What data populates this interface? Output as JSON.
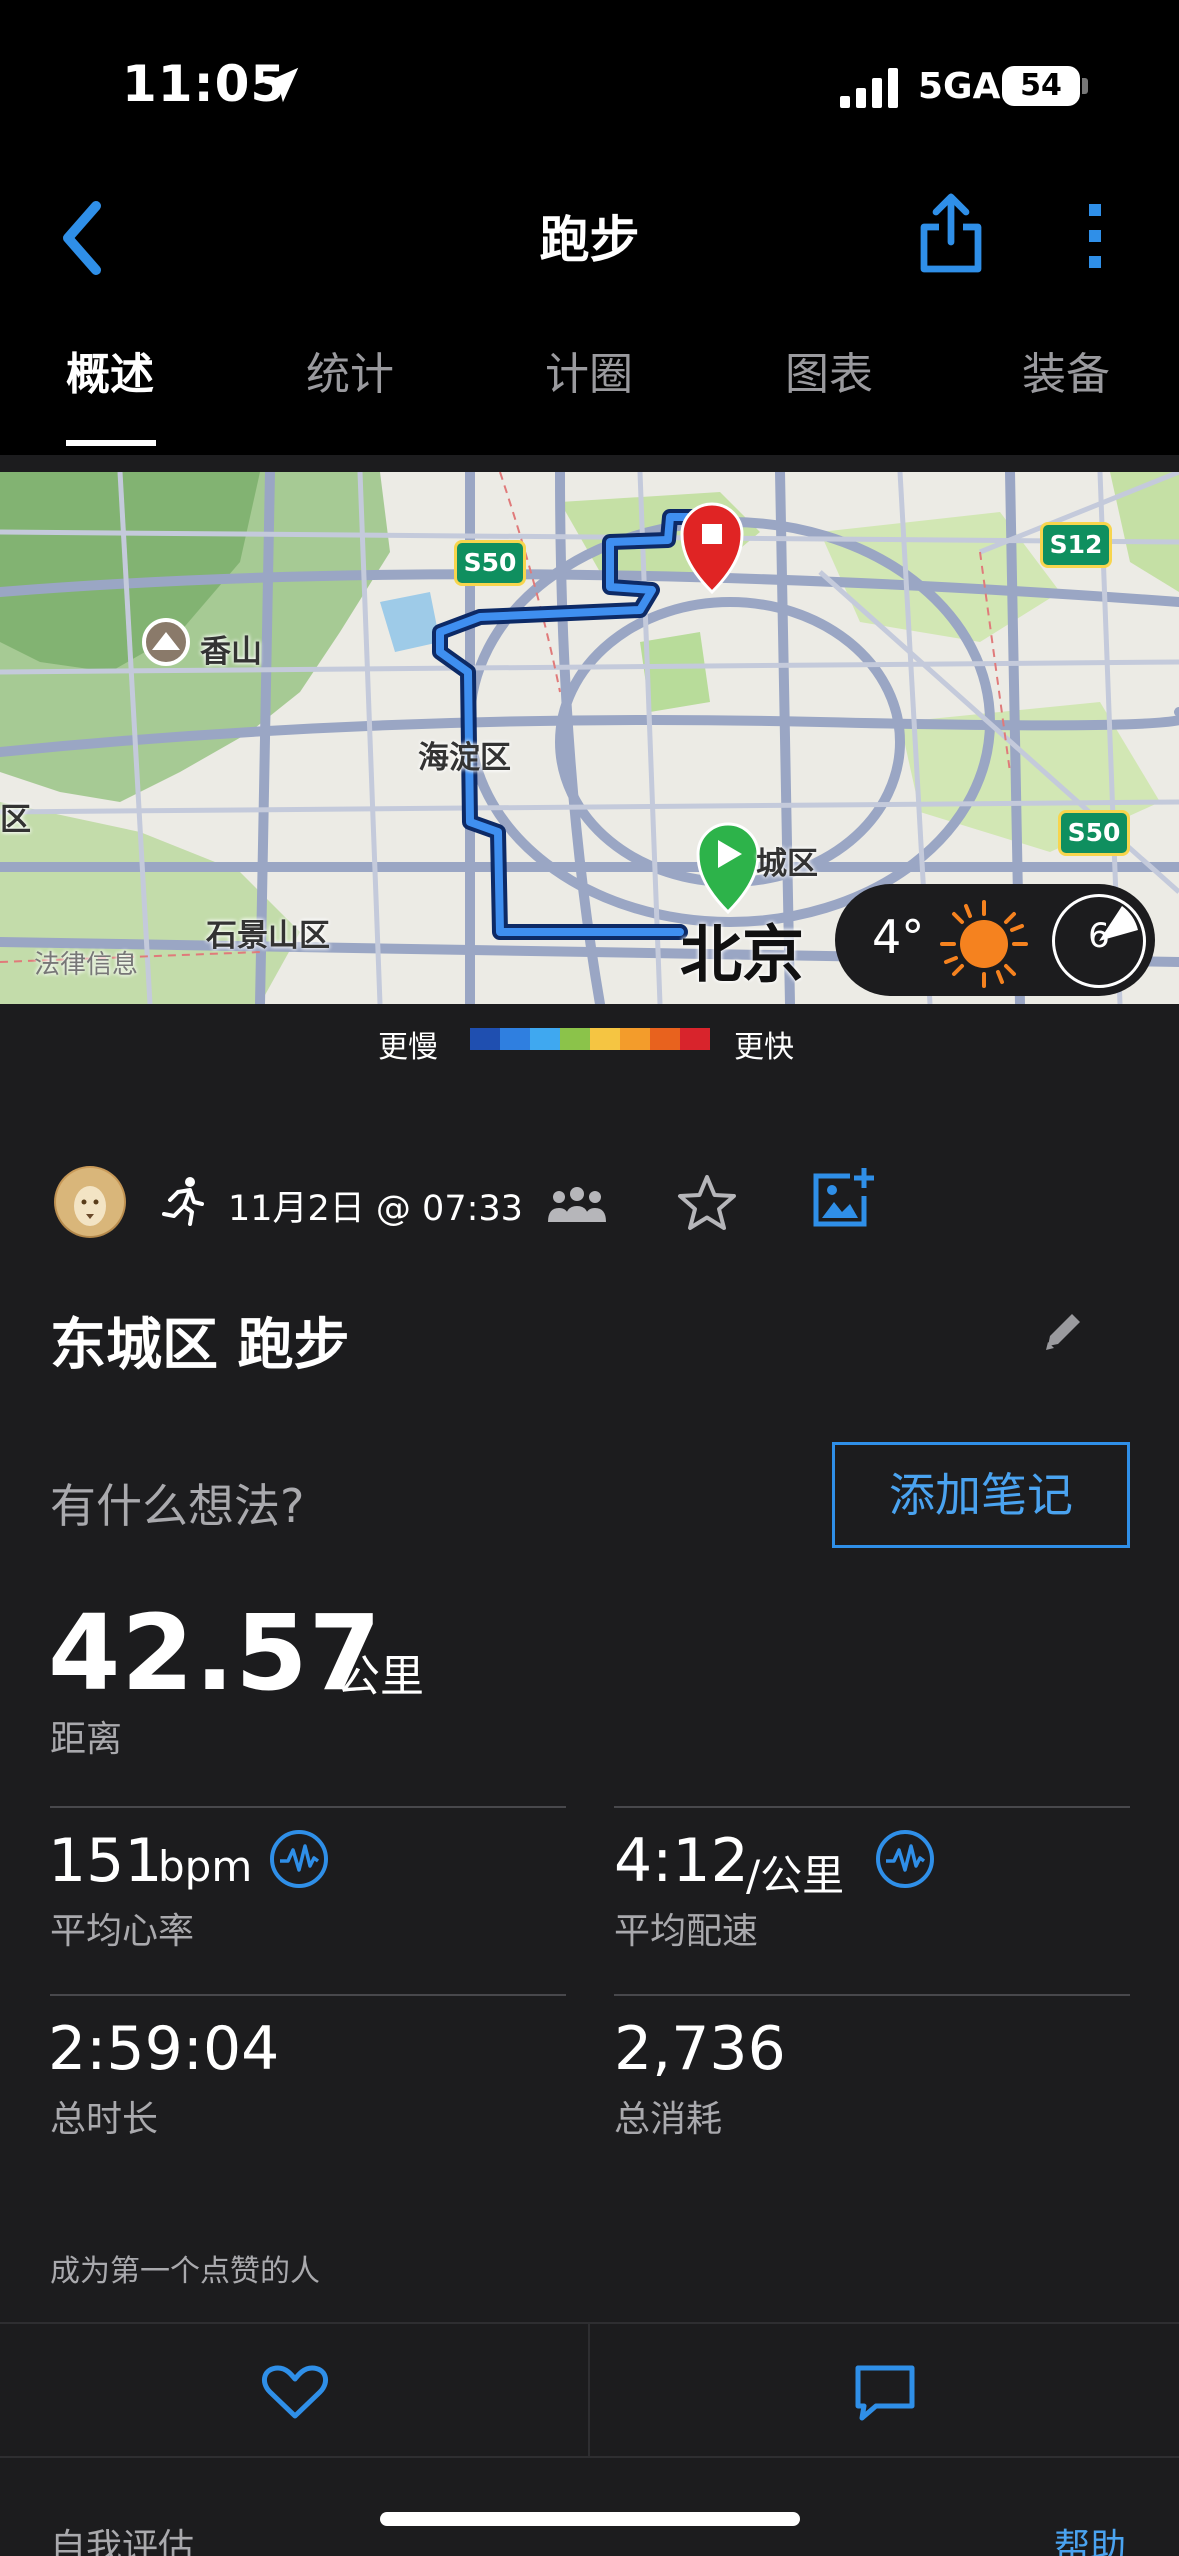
{
  "status_bar": {
    "time": "11:05",
    "network": "5GA",
    "battery": "54"
  },
  "header": {
    "title": "跑步",
    "back_icon": "chevron-left-icon",
    "share_icon": "share-icon",
    "more_icon": "more-vertical-icon"
  },
  "tabs": [
    {
      "label": "概述",
      "active": true
    },
    {
      "label": "统计",
      "active": false
    },
    {
      "label": "计圈",
      "active": false
    },
    {
      "label": "图表",
      "active": false
    },
    {
      "label": "装备",
      "active": false
    }
  ],
  "map": {
    "labels": {
      "xiangshan": "香山",
      "haidian": "海淀区",
      "shijingshan": "石景山区",
      "dongcheng": "城区",
      "beijing": "北京",
      "qu": "区",
      "legal": "法律信息"
    },
    "highways": {
      "s50_top": "S50",
      "s12": "S12",
      "s50_right": "S50"
    },
    "weather": {
      "temperature": "4°",
      "wind": "6",
      "icon": "sun-icon"
    }
  },
  "legend": {
    "slower": "更慢",
    "faster": "更快",
    "colors": [
      "#1f4fb0",
      "#2f7fe0",
      "#3fa8f0",
      "#8bc34a",
      "#f5c542",
      "#f39c2b",
      "#e8621e",
      "#d8242c"
    ]
  },
  "activity": {
    "date": "11月2日 @ 07:33",
    "title": "东城区 跑步",
    "thoughts_placeholder": "有什么想法?",
    "add_note_label": "添加笔记"
  },
  "stats": {
    "distance": {
      "value": "42.57",
      "unit": "公里",
      "label": "距离"
    },
    "heart_rate": {
      "value": "151",
      "unit": "bpm",
      "label": "平均心率"
    },
    "pace": {
      "value": "4:12",
      "unit": "/公里",
      "label": "平均配速"
    },
    "duration": {
      "value": "2:59:04",
      "label": "总时长"
    },
    "calories": {
      "value": "2,736",
      "label": "总消耗"
    }
  },
  "social": {
    "likes_text": "成为第一个点赞的人"
  },
  "footer": {
    "self_eval": "自我评估",
    "help": "帮助"
  },
  "colors": {
    "accent": "#2f8fe8",
    "background": "#1c1c1e",
    "route": "#1f6fe0",
    "start": "#2db34a",
    "end": "#e02424"
  }
}
